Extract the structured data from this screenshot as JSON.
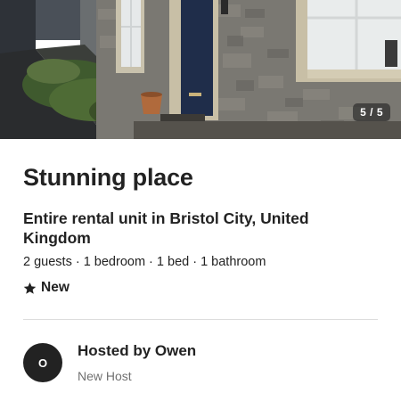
{
  "gallery": {
    "counter": "5 / 5"
  },
  "listing": {
    "title": "Stunning place",
    "subtitle": "Entire rental unit in Bristol City, United Kingdom",
    "details": "2 guests · 1 bedroom · 1 bed · 1 bathroom",
    "rating_label": "New"
  },
  "host": {
    "initial": "O",
    "hosted_by": "Hosted by Owen",
    "status": "New Host"
  },
  "icons": {
    "rating": "star-icon"
  },
  "colors": {
    "text_primary": "#222222",
    "text_secondary": "#717171",
    "divider": "#dddddd",
    "door": "#1f2d4a"
  }
}
